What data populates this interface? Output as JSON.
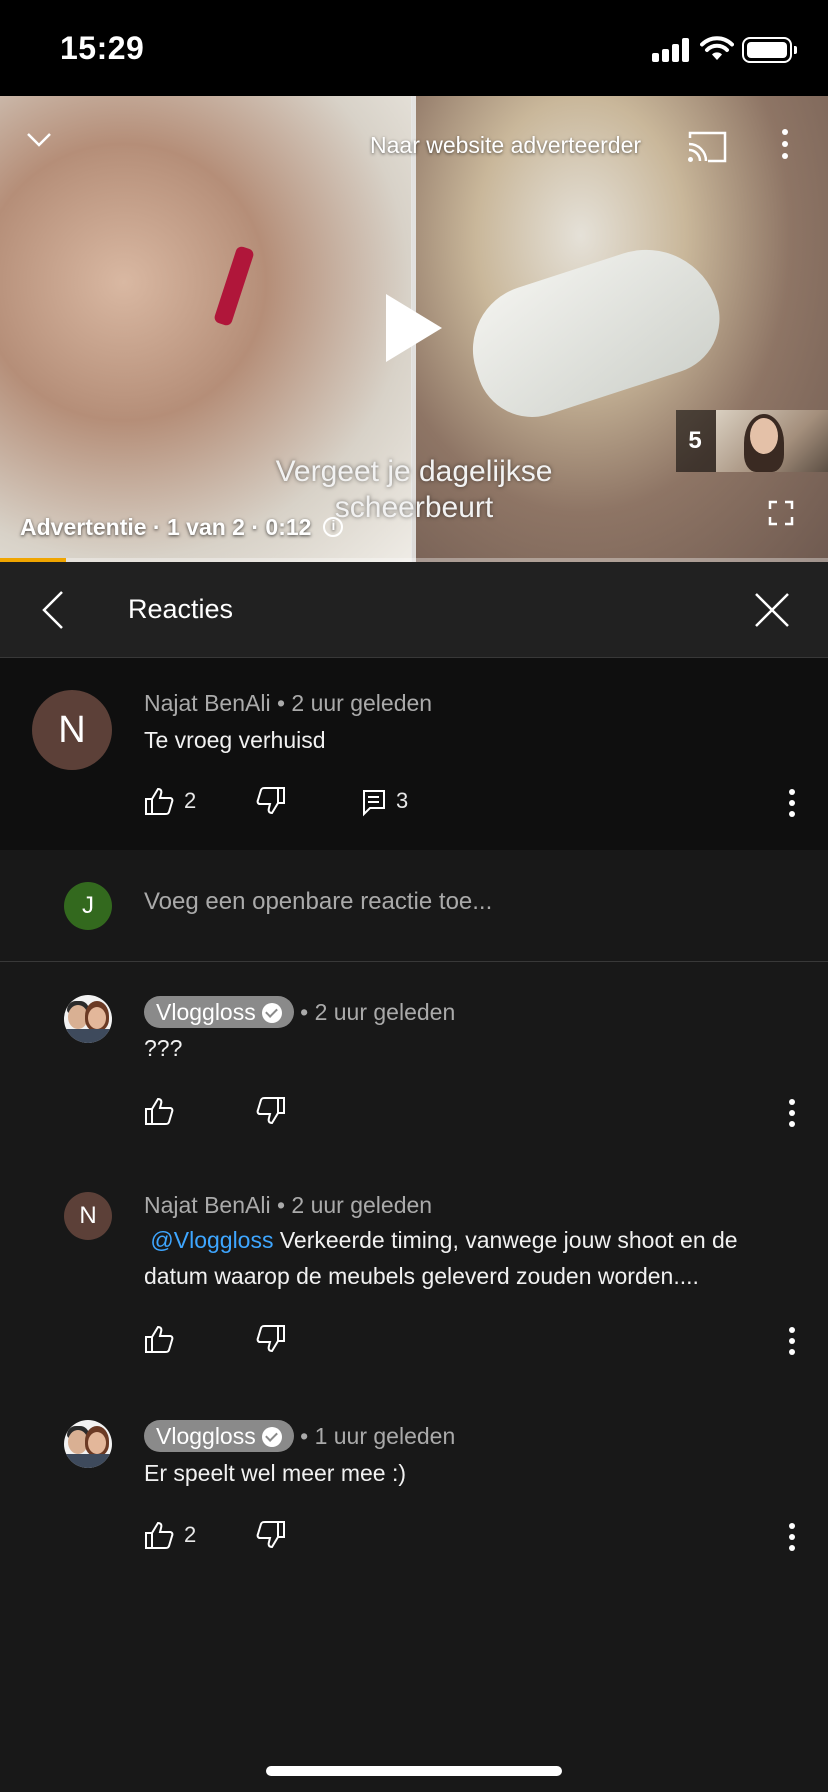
{
  "status_bar": {
    "time": "15:29"
  },
  "video": {
    "advertiser_link": "Naar website adverteerder",
    "subtitle_line1": "Vergeet je dagelijkse",
    "subtitle_line2": "scheerbeurt",
    "ad_info": "Advertentie · 1 van 2 · 0:12",
    "skip_countdown": "5",
    "progress": 0.08,
    "progress_color": "#f0a500"
  },
  "panel": {
    "title": "Reacties"
  },
  "parent_comment": {
    "avatar_letter": "N",
    "avatar_color": "#5c4038",
    "author": "Najat BenAli",
    "time": " • 2 uur geleden",
    "text": "Te vroeg verhuisd",
    "likes": "2",
    "replies": "3"
  },
  "add_reply": {
    "avatar_letter": "J",
    "avatar_color": "#33691e",
    "placeholder": "Voeg een openbare reactie toe..."
  },
  "replies": [
    {
      "author": "Vloggloss",
      "verified": true,
      "time": " • 2 uur geleden",
      "text": "???",
      "likes": ""
    },
    {
      "author": "Najat BenAli",
      "verified": false,
      "avatar_letter": "N",
      "time": " • 2 uur geleden",
      "mention": "@Vloggloss",
      "text_line1": " Verkeerde timing, vanwege jouw shoot en de",
      "text_line2": "datum waarop de meubels geleverd zouden worden....",
      "likes": ""
    },
    {
      "author": "Vloggloss",
      "verified": true,
      "time": " • 1 uur geleden",
      "text": "Er speelt wel meer mee :)",
      "likes": "2"
    }
  ],
  "icons": {
    "collapse": "chevron-down-icon",
    "cast": "cast-icon",
    "more": "more-vert-icon",
    "play": "play-icon",
    "info": "info-icon",
    "fullscreen": "fullscreen-icon",
    "back": "back-icon",
    "close": "close-icon",
    "like": "thumb-up-icon",
    "dislike": "thumb-down-icon",
    "reply": "comment-icon",
    "verified": "check-circle-icon"
  }
}
